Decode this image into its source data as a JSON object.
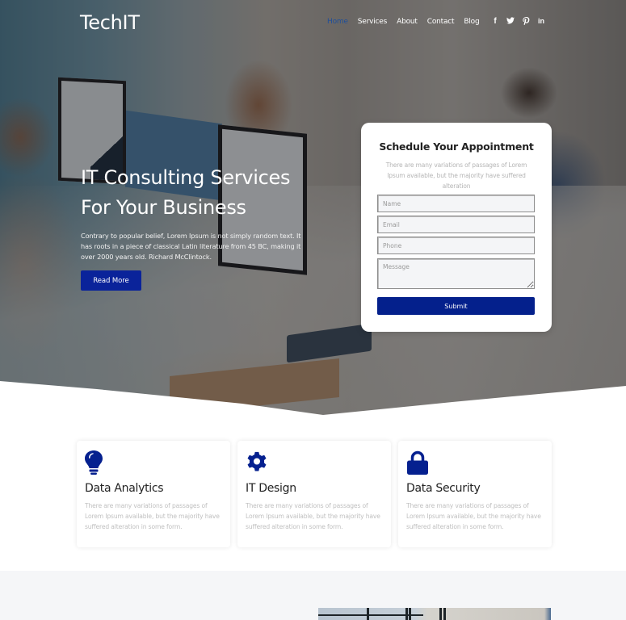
{
  "header": {
    "logo": "TechIT",
    "nav": [
      {
        "label": "Home",
        "active": true
      },
      {
        "label": "Services",
        "active": false
      },
      {
        "label": "About",
        "active": false
      },
      {
        "label": "Contact",
        "active": false
      },
      {
        "label": "Blog",
        "active": false
      }
    ],
    "social": [
      {
        "icon": "facebook-icon",
        "glyph": "f"
      },
      {
        "icon": "twitter-icon",
        "glyph": "🐦"
      },
      {
        "icon": "pinterest-icon",
        "glyph": "P"
      },
      {
        "icon": "linkedin-icon",
        "glyph": "in"
      }
    ]
  },
  "hero": {
    "title": "IT Consulting Services For Your Business",
    "text": "Contrary to popular belief, Lorem Ipsum is not simply random text. It has roots in a piece of classical Latin literature from 45 BC, making it over 2000 years old. Richard McClintock.",
    "button": "Read More"
  },
  "appointment": {
    "title": "Schedule Your Appointment",
    "description": "There are many variations of passages of Lorem Ipsum available, but the majority have suffered alteration",
    "fields": {
      "name": {
        "placeholder": "Name",
        "value": ""
      },
      "email": {
        "placeholder": "Email",
        "value": ""
      },
      "phone": {
        "placeholder": "Phone",
        "value": ""
      },
      "message": {
        "placeholder": "Message",
        "value": ""
      }
    },
    "submit": "Submit"
  },
  "services": [
    {
      "icon": "lightbulb-icon",
      "title": "Data Analytics",
      "text": "There are many variations of passages of Lorem Ipsum available, but the majority have suffered alteration in some form."
    },
    {
      "icon": "gear-icon",
      "title": "IT Design",
      "text": "There are many variations of passages of Lorem Ipsum available, but the majority have suffered alteration in some form."
    },
    {
      "icon": "lock-icon",
      "title": "Data Security",
      "text": "There are many variations of passages of Lorem Ipsum available, but the majority have suffered alteration in some form."
    }
  ],
  "colors": {
    "primary": "#04208c",
    "nav_active": "#1f4f9a",
    "icon": "#05208f",
    "section_bg": "#f5f6f8"
  }
}
